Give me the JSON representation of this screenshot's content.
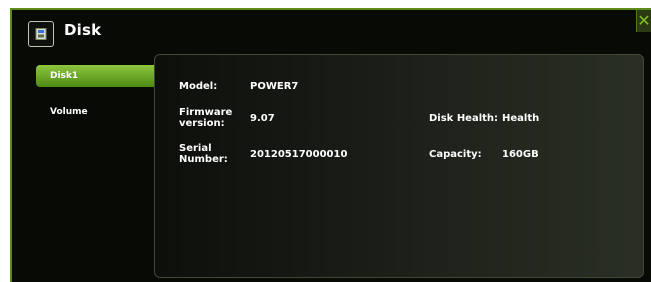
{
  "window": {
    "title": "Disk",
    "close_glyph": "✕"
  },
  "icons": {
    "title_icon": "disk-drive-icon",
    "close_icon": "close-icon"
  },
  "colors": {
    "accent": "#8ec63f",
    "accent_dark": "#4c8a12",
    "frame": "#5d8a1c",
    "background": "#080a06"
  },
  "nav": {
    "items": [
      {
        "label": "Disk1",
        "active": true
      },
      {
        "label": "Volume",
        "active": false
      }
    ]
  },
  "details": {
    "model_label": "Model:",
    "model_value": "POWER7",
    "firmware_label_1": "Firmware",
    "firmware_label_2": "version:",
    "firmware_value": "9.07",
    "serial_label_1": "Serial",
    "serial_label_2": "Number:",
    "serial_value": "20120517000010",
    "health_label": "Disk Health:",
    "health_value": "Health",
    "capacity_label": "Capacity:",
    "capacity_value": "160GB"
  }
}
